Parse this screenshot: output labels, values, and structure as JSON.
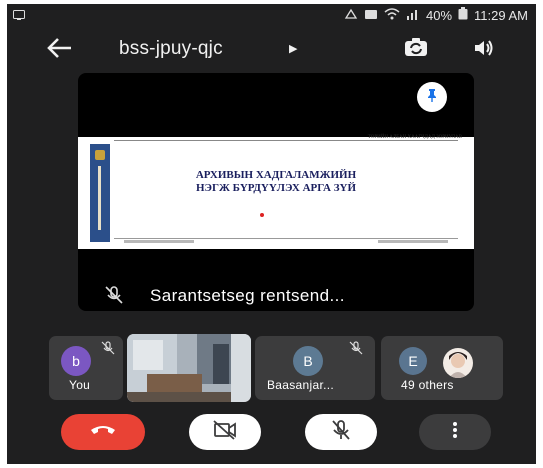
{
  "status_bar": {
    "battery": "40%",
    "time": "11:29 AM"
  },
  "header": {
    "meeting_code": "bss-jpuy-qjc"
  },
  "main_tile": {
    "presenter_name": "Sarantsetseg rentsend...",
    "slide": {
      "top_text": "ТӨРИЙН АЛБАН ХААГЧДАД ЗОРИУЛАВ",
      "title_line1": "АРХИВЫН ХАДГАЛАМЖИЙН",
      "title_line2": "НЭГЖ БҮРДҮҮЛЭХ АРГА ЗҮЙ"
    }
  },
  "participants": [
    {
      "initial": "b",
      "label": "You",
      "color": "#7b57c2"
    },
    {
      "label": "",
      "type": "video"
    },
    {
      "initial": "B",
      "label": "Baasanjar...",
      "color": "#5d7a93"
    },
    {
      "initial": "E",
      "label": "49 others",
      "color": "#5a7590"
    }
  ],
  "colors": {
    "end_call": "#e94235",
    "control_light": "#ffffff",
    "control_dark": "#3c3c3d"
  }
}
